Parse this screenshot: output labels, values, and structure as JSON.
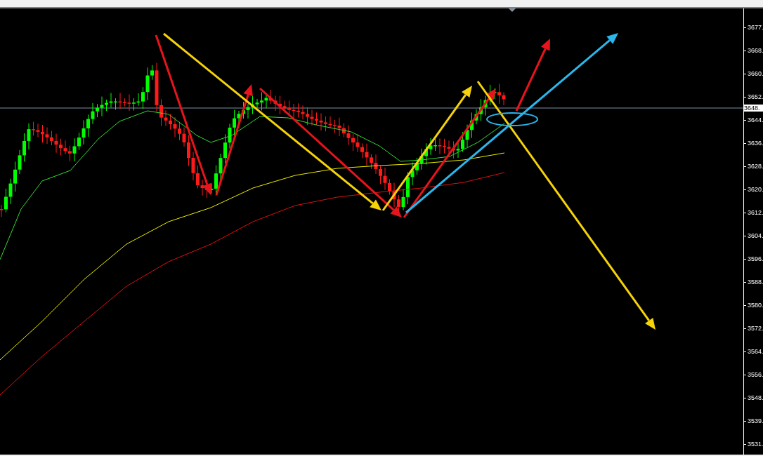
{
  "price_axis": {
    "labels": [
      "3677.",
      "3668.",
      "3660.",
      "3652.",
      "3644.",
      "3636.",
      "3628.",
      "3620.",
      "3612.",
      "3604.",
      "3596.",
      "3588.",
      "3580.",
      "3572.",
      "3564.",
      "3556.",
      "3548.",
      "3539.",
      "3531."
    ]
  },
  "current_price": {
    "label": "3648."
  }
}
